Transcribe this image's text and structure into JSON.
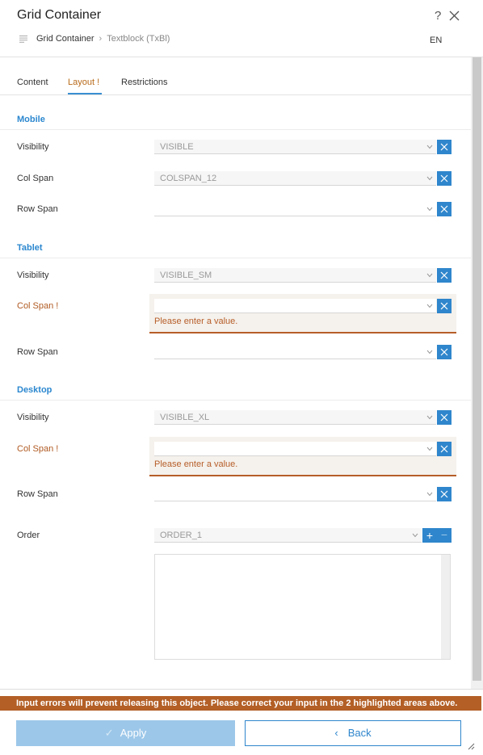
{
  "header": {
    "title": "Grid Container",
    "help": "?",
    "breadcrumb": {
      "parent": "Grid Container",
      "separator": "›",
      "current": "Textblock (TxBl)"
    },
    "language": "EN"
  },
  "tabs": [
    {
      "label": "Content"
    },
    {
      "label": "Layout !"
    },
    {
      "label": "Restrictions"
    }
  ],
  "mobile": {
    "title": "Mobile",
    "visibility": {
      "label": "Visibility",
      "value": "VISIBLE"
    },
    "colspan": {
      "label": "Col Span",
      "value": "COLSPAN_12"
    },
    "rowspan": {
      "label": "Row Span",
      "value": ""
    }
  },
  "tablet": {
    "title": "Tablet",
    "visibility": {
      "label": "Visibility",
      "value": "VISIBLE_SM"
    },
    "colspan": {
      "label": "Col Span !",
      "value": "",
      "error": "Please enter a value."
    },
    "rowspan": {
      "label": "Row Span",
      "value": ""
    }
  },
  "desktop": {
    "title": "Desktop",
    "visibility": {
      "label": "Visibility",
      "value": "VISIBLE_XL"
    },
    "colspan": {
      "label": "Col Span !",
      "value": "",
      "error": "Please enter a value."
    },
    "rowspan": {
      "label": "Row Span",
      "value": ""
    }
  },
  "order": {
    "label": "Order",
    "value": "ORDER_1",
    "plus": "+",
    "minus": "−"
  },
  "footer": {
    "error_message": "Input errors will prevent releasing this object. Please correct your input in the 2 highlighted areas above.",
    "apply_label": "Apply",
    "apply_icon": "✓",
    "back_label": "Back",
    "back_icon": "‹"
  },
  "colors": {
    "accent": "#2f86cc",
    "error": "#b35f26",
    "apply_disabled": "#9cc7e9"
  }
}
